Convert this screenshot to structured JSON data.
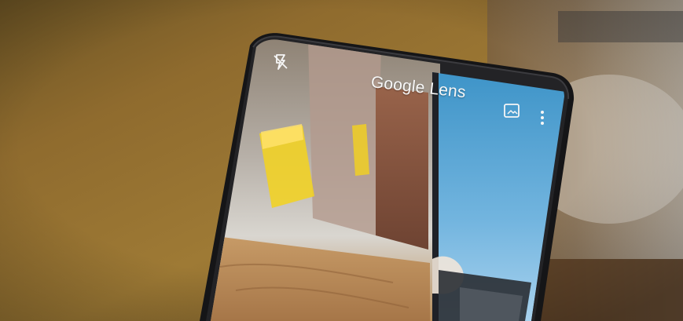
{
  "photo": {
    "subject": "smartphone",
    "app": {
      "title": "Google Lens"
    },
    "icons": {
      "flash": "flash-off-icon",
      "gallery": "gallery-icon",
      "menu": "more-vert-icon"
    },
    "colors": {
      "background_blur": "#8a6a2e",
      "phone_bezel": "#151517",
      "screen_sky": "#4f9fd1",
      "stool_yellow": "#f1d126"
    }
  }
}
